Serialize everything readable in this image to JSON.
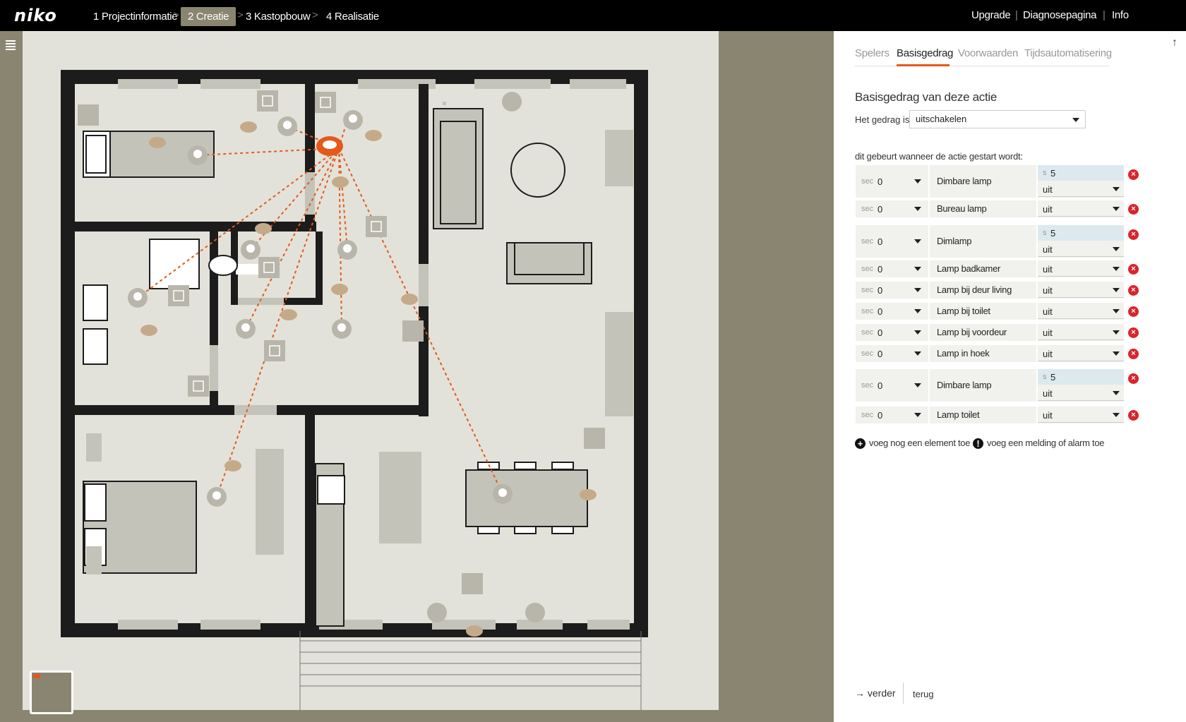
{
  "header": {
    "logo": "niko",
    "steps": [
      {
        "label": "1 Projectinformatie",
        "active": false
      },
      {
        "label": "2 Creatie",
        "active": true
      },
      {
        "label": "3 Kastopbouw",
        "active": false
      },
      {
        "label": "4 Realisatie",
        "active": false
      }
    ],
    "links": [
      "Upgrade",
      "Diagnosepagina",
      "Info"
    ],
    "separator": "|",
    "chevron": ">"
  },
  "panel": {
    "scroll_top_icon": "↑",
    "tabs": [
      {
        "label": "Spelers",
        "active": false
      },
      {
        "label": "Basisgedrag",
        "active": true
      },
      {
        "label": "Voorwaarden",
        "active": false
      },
      {
        "label": "Tijdsautomatisering",
        "active": false
      }
    ],
    "section_title": "Basisgedrag van deze actie",
    "behavior_label": "Het gedrag is",
    "behavior_value": "uitschakelen",
    "trigger_label": "dit gebeurt wanneer de actie gestart wordt:",
    "rows": [
      {
        "sec_label": "sec",
        "sec": "0",
        "name": "Dimbare lamp",
        "s_label": "s",
        "s": "5",
        "state": "uit"
      },
      {
        "sec_label": "sec",
        "sec": "0",
        "name": "Bureau lamp",
        "state": "uit"
      },
      {
        "sec_label": "sec",
        "sec": "0",
        "name": "Dimlamp",
        "s_label": "s",
        "s": "5",
        "state": "uit"
      },
      {
        "sec_label": "sec",
        "sec": "0",
        "name": "Lamp badkamer",
        "state": "uit"
      },
      {
        "sec_label": "sec",
        "sec": "0",
        "name": "Lamp bij deur living",
        "state": "uit"
      },
      {
        "sec_label": "sec",
        "sec": "0",
        "name": "Lamp bij toilet",
        "state": "uit"
      },
      {
        "sec_label": "sec",
        "sec": "0",
        "name": "Lamp bij voordeur",
        "state": "uit"
      },
      {
        "sec_label": "sec",
        "sec": "0",
        "name": "Lamp in hoek",
        "state": "uit"
      },
      {
        "sec_label": "sec",
        "sec": "0",
        "name": "Dimbare lamp",
        "s_label": "s",
        "s": "5",
        "state": "uit"
      },
      {
        "sec_label": "sec",
        "sec": "0",
        "name": "Lamp toilet",
        "state": "uit"
      }
    ],
    "delete_icon": "×",
    "add_element_icon": "+",
    "add_element": "voeg nog een element toe",
    "add_alarm_icon": "!",
    "add_alarm": "voeg een melding of alarm toe",
    "next_arrow": "→",
    "next": "verder",
    "back": "terug"
  },
  "colors": {
    "accent": "#e35a1a",
    "delete": "#d9252c",
    "wall": "#1c1c1c",
    "furniture": "#c4c3b9",
    "device": "#b8b5aa",
    "sensor": "#c5aa8a",
    "sidebar": "#8a8571"
  }
}
